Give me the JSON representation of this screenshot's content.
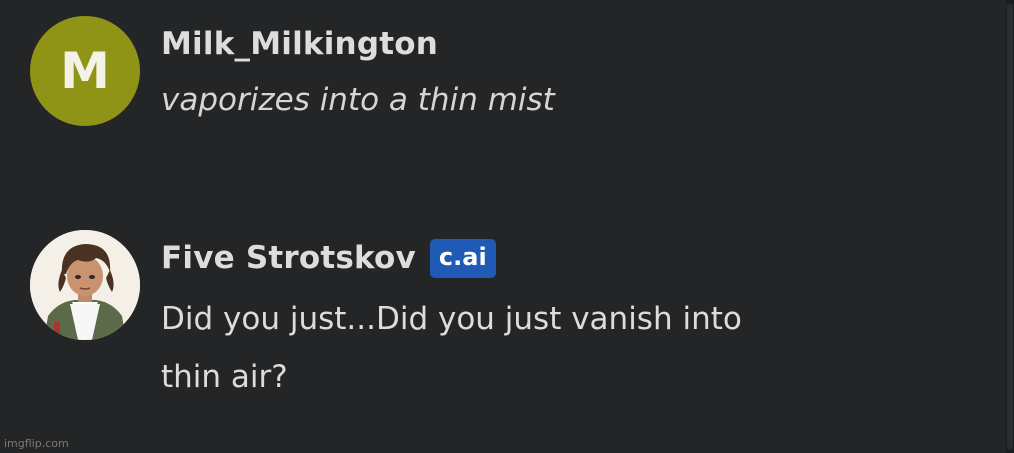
{
  "messages": [
    {
      "author": "Milk_Milkington",
      "avatar_letter": "M",
      "avatar_color": "#8f9416",
      "text": "vaporizes into a thin mist",
      "italic": true
    },
    {
      "author": "Five Strotskov",
      "badge": "c.ai",
      "badge_color": "#1f5bb5",
      "avatar_icon": "character-portrait-icon",
      "text": "Did you just...Did you just vanish into thin air?",
      "italic": false
    }
  ],
  "watermark": "imgflip.com"
}
